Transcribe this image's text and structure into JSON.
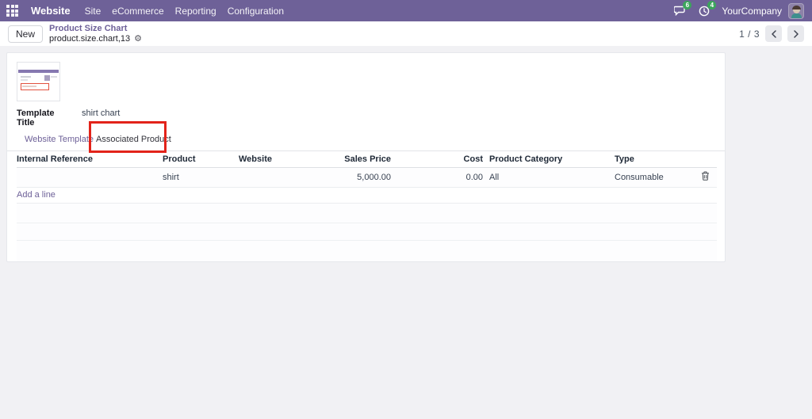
{
  "navbar": {
    "app_name": "Website",
    "menus": [
      "Site",
      "eCommerce",
      "Reporting",
      "Configuration"
    ],
    "messages_badge": "6",
    "activities_badge": "4",
    "company": "YourCompany",
    "accent_color": "#6e6198",
    "badge_color": "#3ca55c"
  },
  "control_panel": {
    "new_button": "New",
    "breadcrumb_title": "Product Size Chart",
    "breadcrumb_record": "product.size.chart,13",
    "gear_icon": "gear",
    "pager": "1 / 3"
  },
  "form": {
    "template_title_label": "Template Title",
    "template_title_value": "shirt chart",
    "tabs": [
      {
        "label": "Website Template",
        "active": false
      },
      {
        "label": "Associated Product",
        "active": true,
        "highlight_color": "#e2231a"
      }
    ],
    "table": {
      "headers": [
        "Internal Reference",
        "Product",
        "Website",
        "Sales Price",
        "Cost",
        "Product Category",
        "Type"
      ],
      "rows": [
        {
          "internal_reference": "",
          "product": "shirt",
          "website": "",
          "sales_price": "5,000.00",
          "cost": "0.00",
          "product_category": "All",
          "type": "Consumable"
        }
      ],
      "add_line_label": "Add a line"
    }
  }
}
